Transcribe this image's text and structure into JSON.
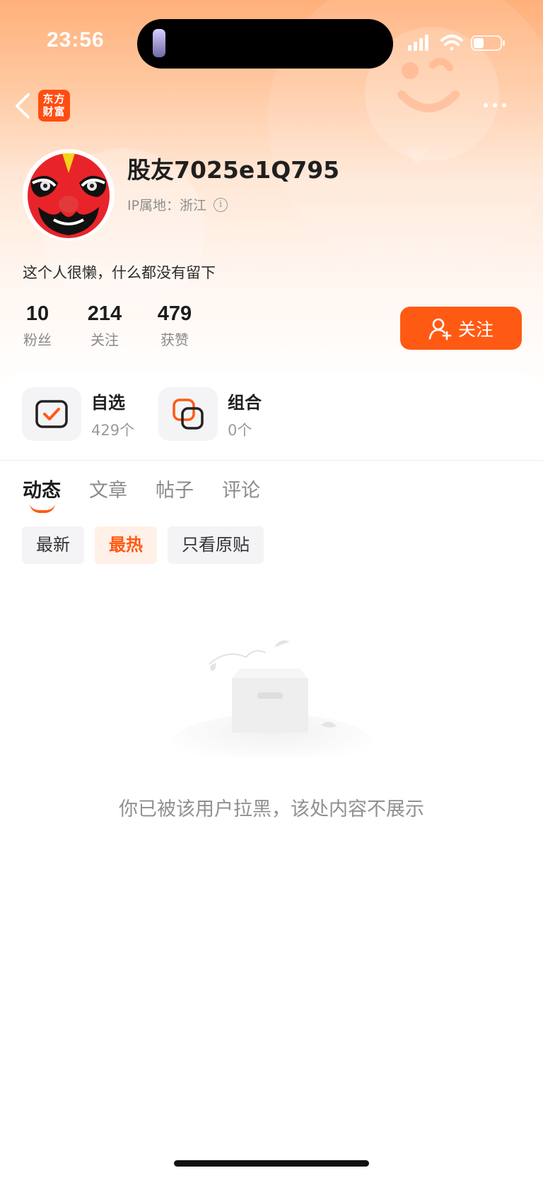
{
  "status_bar": {
    "time": "23:56"
  },
  "nav": {
    "app_logo_line1": "东方",
    "app_logo_line2": "财富"
  },
  "profile": {
    "username": "股友7025e1Q795",
    "ip_location": "IP属地：浙江",
    "bio": "这个人很懒，什么都没有留下"
  },
  "stats": [
    {
      "value": "10",
      "label": "粉丝"
    },
    {
      "value": "214",
      "label": "关注"
    },
    {
      "value": "479",
      "label": "获赞"
    }
  ],
  "follow_button": {
    "label": "关注"
  },
  "features": [
    {
      "title": "自选",
      "count": "429个",
      "icon": "check-square-icon"
    },
    {
      "title": "组合",
      "count": "0个",
      "icon": "stacked-squares-icon"
    }
  ],
  "tabs": [
    {
      "label": "动态",
      "active": true
    },
    {
      "label": "文章",
      "active": false
    },
    {
      "label": "帖子",
      "active": false
    },
    {
      "label": "评论",
      "active": false
    }
  ],
  "filters": [
    {
      "label": "最新",
      "active": false
    },
    {
      "label": "最热",
      "active": true
    },
    {
      "label": "只看原贴",
      "active": false
    }
  ],
  "empty_state": {
    "message": "你已被该用户拉黑，该处内容不展示"
  },
  "colors": {
    "accent": "#ff5a14",
    "header_top": "#ffb07a"
  }
}
